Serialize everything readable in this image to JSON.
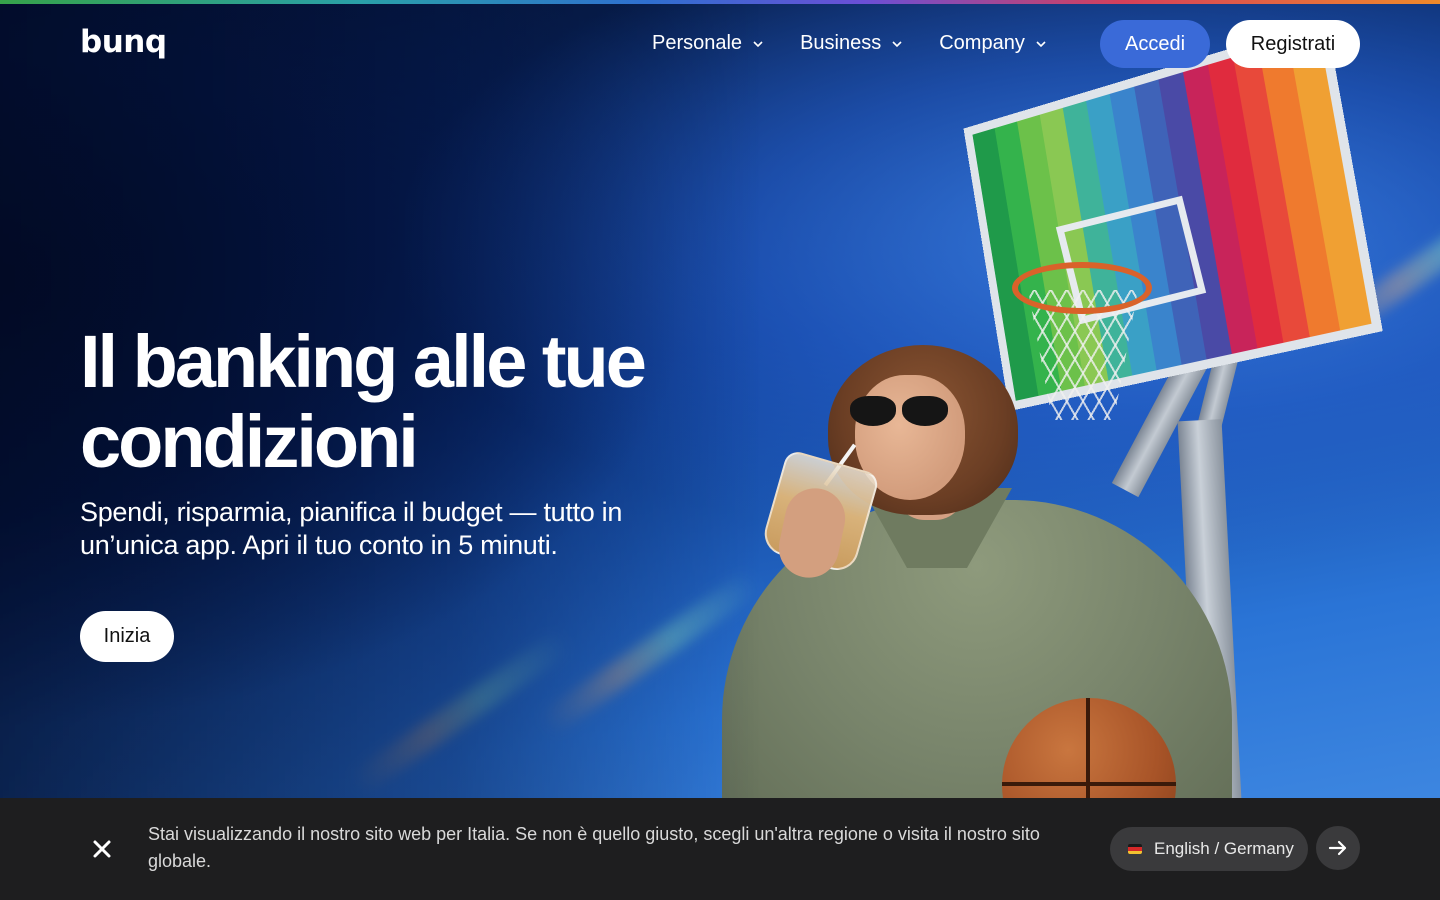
{
  "brand": {
    "logo": "bunq"
  },
  "nav": {
    "items": [
      {
        "label": "Personale",
        "icon": "chevron-down-icon"
      },
      {
        "label": "Business",
        "icon": "chevron-down-icon"
      },
      {
        "label": "Company",
        "icon": "chevron-down-icon"
      }
    ],
    "login_label": "Accedi",
    "signup_label": "Registrati"
  },
  "hero": {
    "headline_line1": "Il banking alle tue",
    "headline_line2": "condizioni",
    "subheadline": "Spendi, risparmia, pianifica il budget — tutto in un’unica app. Apri il tuo conto in 5 minuti.",
    "cta_label": "Inizia"
  },
  "region_banner": {
    "message": "Stai visualizzando il nostro sito web per Italia. Se non è quello giusto, scegli un'altra regione o visita il nostro sito globale.",
    "selected_region": "English / Germany",
    "close_icon": "close-icon",
    "go_icon": "arrow-right-icon",
    "flag_icon": "germany-flag-icon"
  },
  "colors": {
    "accent_blue": "#3a6ad8",
    "banner_bg": "#1e1e1f",
    "white": "#ffffff"
  }
}
